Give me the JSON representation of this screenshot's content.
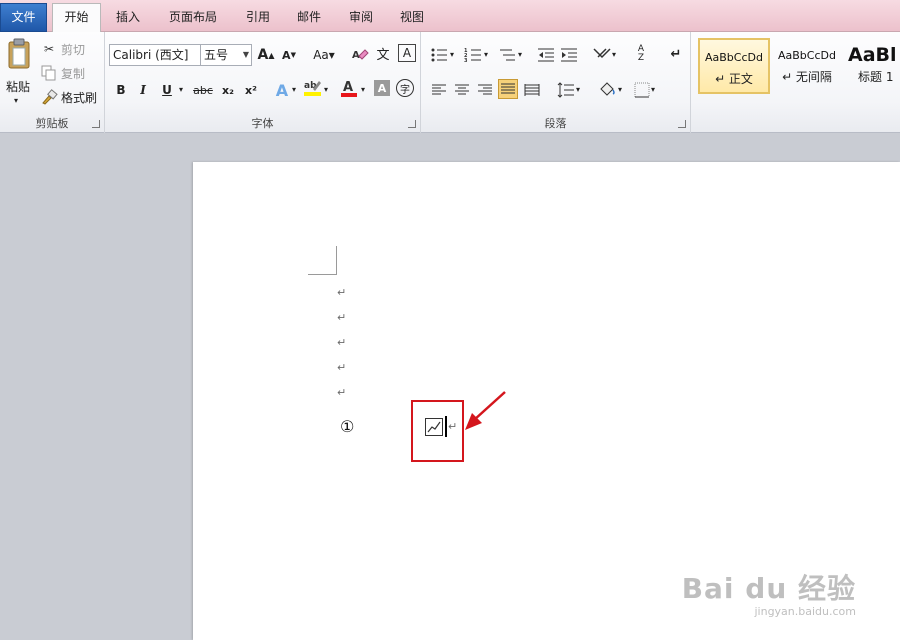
{
  "tabs": [
    {
      "label": "文件"
    },
    {
      "label": "开始"
    },
    {
      "label": "插入"
    },
    {
      "label": "页面布局"
    },
    {
      "label": "引用"
    },
    {
      "label": "邮件"
    },
    {
      "label": "审阅"
    },
    {
      "label": "视图"
    }
  ],
  "clipboard": {
    "paste_label": "粘贴",
    "cut_label": "剪切",
    "copy_label": "复制",
    "format_painter_label": "格式刷",
    "group_title": "剪贴板"
  },
  "font": {
    "font_name": "Calibri (西文]",
    "font_size": "五号",
    "bold": "B",
    "italic": "I",
    "underline": "U",
    "strike": "abc",
    "subscript": "x₂",
    "superscript": "x²",
    "char_border": "A",
    "enclosed_char": "字",
    "group_title": "字体"
  },
  "paragraph": {
    "group_title": "段落"
  },
  "styles": {
    "items": [
      {
        "sample": "AaBbCcDd",
        "name": "↵ 正文"
      },
      {
        "sample": "AaBbCcDd",
        "name": "↵ 无间隔"
      },
      {
        "sample": "AaBl",
        "name": "标题 1"
      }
    ]
  },
  "document": {
    "pilcrow": "↵",
    "circled_number": "①"
  },
  "watermark": {
    "main": "Bai du 经验",
    "sub": "jingyan.baidu.com"
  },
  "colors": {
    "highlight_box": "#d4161d",
    "arrow": "#d4161d",
    "font_color_bar": "#e8161b",
    "highlighter_bar": "#fff200"
  }
}
